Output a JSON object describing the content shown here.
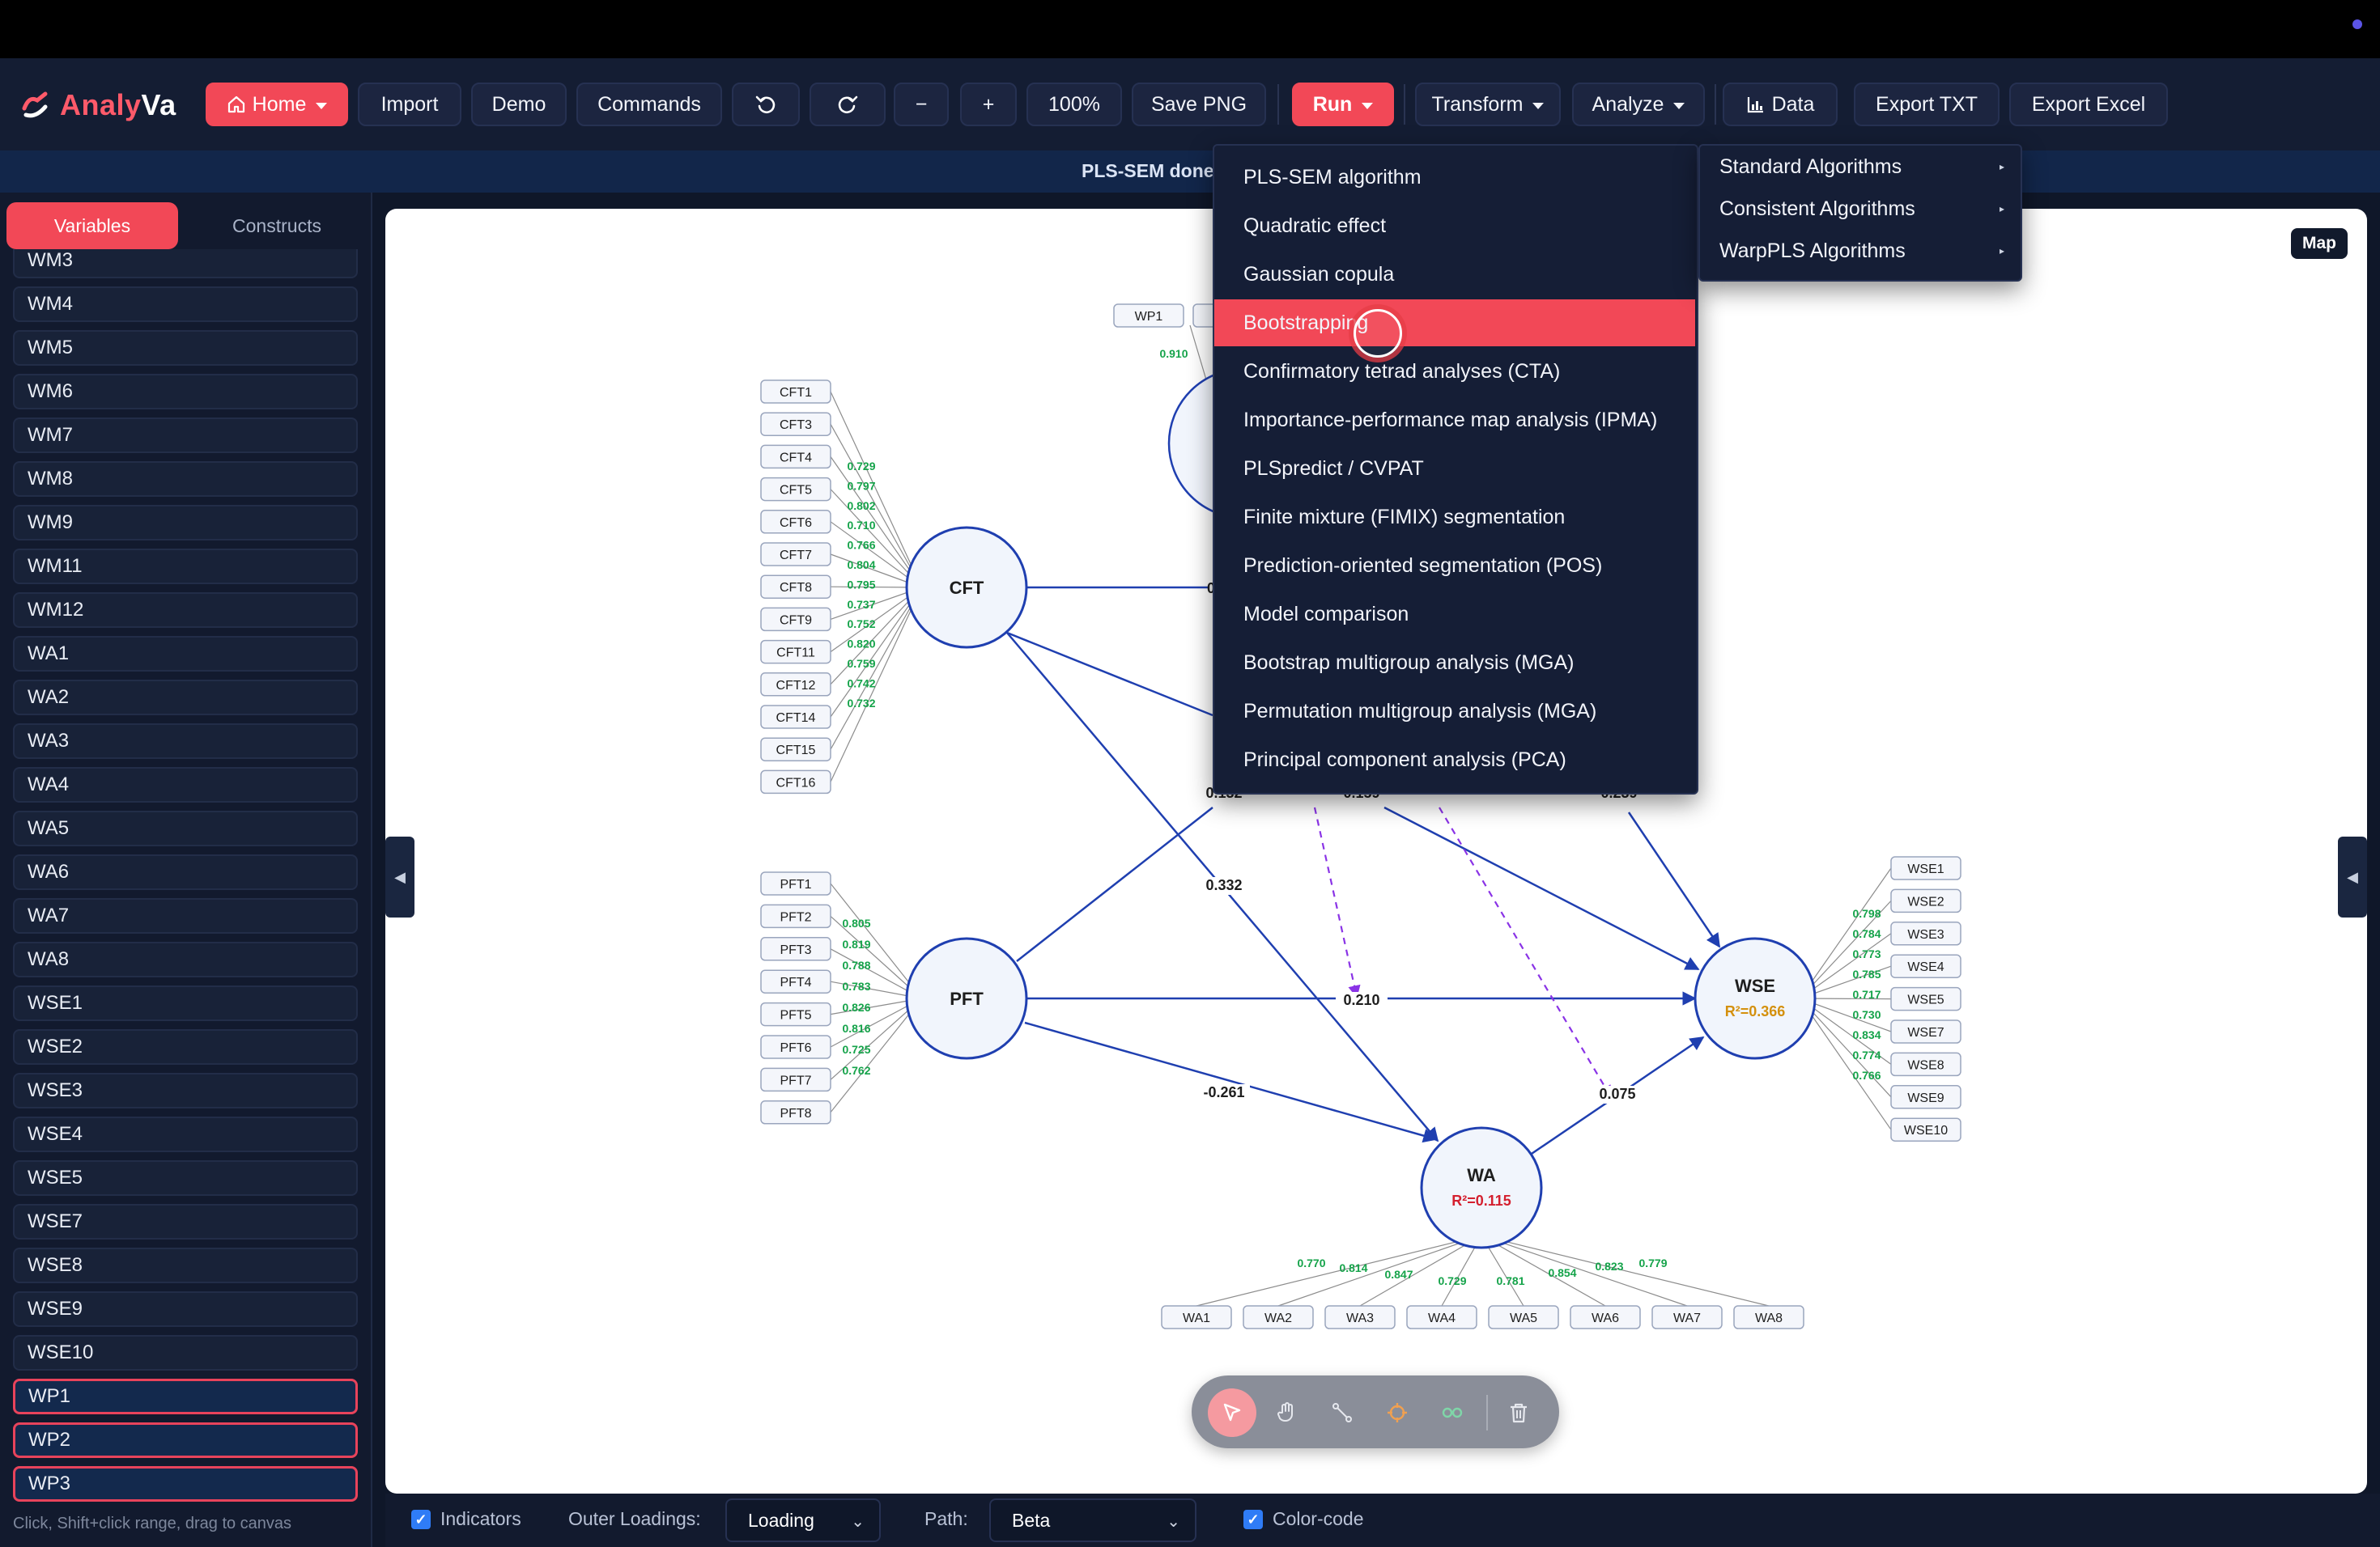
{
  "app": {
    "logo_part1": "Analy",
    "logo_part2": "Va"
  },
  "toolbar": {
    "home": "Home",
    "import": "Import",
    "demo": "Demo",
    "commands": "Commands",
    "zoom_out": "−",
    "zoom_in": "+",
    "zoom": "100%",
    "save_png": "Save PNG",
    "run": "Run",
    "transform": "Transform",
    "analyze": "Analyze",
    "data": "Data",
    "export_txt": "Export TXT",
    "export_excel": "Export Excel"
  },
  "status": {
    "text": "PLS-SEM done"
  },
  "sidebar": {
    "tabs": [
      "Variables",
      "Constructs"
    ],
    "variables": [
      "WM3",
      "WM4",
      "WM5",
      "WM6",
      "WM7",
      "WM8",
      "WM9",
      "WM11",
      "WM12",
      "WA1",
      "WA2",
      "WA3",
      "WA4",
      "WA5",
      "WA6",
      "WA7",
      "WA8",
      "WSE1",
      "WSE2",
      "WSE3",
      "WSE4",
      "WSE5",
      "WSE7",
      "WSE8",
      "WSE9",
      "WSE10",
      "WP1",
      "WP2",
      "WP3"
    ],
    "selected": [
      "WP1",
      "WP2",
      "WP3"
    ],
    "hint": "Click, Shift+click range, drag to canvas"
  },
  "canvas": {
    "map_button": "Map",
    "left_handle": "◀",
    "right_handle": "◀"
  },
  "run_menu": {
    "items": [
      "PLS-SEM algorithm",
      "Quadratic effect",
      "Gaussian copula",
      "Bootstrapping",
      "Confirmatory tetrad analyses (CTA)",
      "Importance-performance map analysis (IPMA)",
      "PLSpredict / CVPAT",
      "Finite mixture (FIMIX) segmentation",
      "Prediction-oriented segmentation (POS)",
      "Model comparison",
      "Bootstrap multigroup analysis (MGA)",
      "Permutation multigroup analysis (MGA)",
      "Principal component analysis (PCA)"
    ],
    "highlighted": "Bootstrapping"
  },
  "algorithm_menu": {
    "items": [
      "Standard Algorithms",
      "Consistent Algorithms",
      "WarpPLS Algorithms"
    ]
  },
  "model": {
    "constructs": {
      "cft": {
        "name": "CFT"
      },
      "pft": {
        "name": "PFT"
      },
      "wa": {
        "name": "WA",
        "r2": "R²=0.115"
      },
      "wse": {
        "name": "WSE",
        "r2": "R²=0.366"
      },
      "wp_partial": {
        "name": ""
      }
    },
    "cft_indicators": [
      "CFT1",
      "CFT3",
      "CFT4",
      "CFT5",
      "CFT6",
      "CFT7",
      "CFT8",
      "CFT9",
      "CFT11",
      "CFT12",
      "CFT14",
      "CFT15",
      "CFT16"
    ],
    "cft_loadings": [
      "0.729",
      "0.797",
      "0.802",
      "0.710",
      "0.766",
      "0.804",
      "0.795",
      "0.737",
      "0.752",
      "0.820",
      "0.759",
      "0.742",
      "0.732"
    ],
    "pft_indicators": [
      "PFT1",
      "PFT2",
      "PFT3",
      "PFT4",
      "PFT5",
      "PFT6",
      "PFT7",
      "PFT8"
    ],
    "pft_loadings": [
      "0.805",
      "0.819",
      "0.788",
      "0.783",
      "0.826",
      "0.816",
      "0.725",
      "0.762"
    ],
    "wse_indicators": [
      "WSE1",
      "WSE2",
      "WSE3",
      "WSE4",
      "WSE5",
      "WSE7",
      "WSE8",
      "WSE9",
      "WSE10"
    ],
    "wse_loadings": [
      "0.798",
      "0.784",
      "0.773",
      "0.785",
      "0.717",
      "0.730",
      "0.834",
      "0.774",
      "0.766"
    ],
    "wa_indicators": [
      "WA1",
      "WA2",
      "WA3",
      "WA4",
      "WA5",
      "WA6",
      "WA7",
      "WA8"
    ],
    "wa_loadings": [
      "0.770",
      "0.814",
      "0.847",
      "0.729",
      "0.781",
      "0.854",
      "0.823",
      "0.779"
    ],
    "wp_indicator": "WP1",
    "wp_loading": "0.910",
    "paths": {
      "cft_wa": "0.332",
      "pft_wa": "-0.261",
      "pft_wse": "0.210",
      "wa_wse": "0.075",
      "p1": "0.132",
      "p2": "0.159",
      "p3": "0.239",
      "cft_partial": "0"
    }
  },
  "bottom": {
    "indicators_label": "Indicators",
    "outer_loadings_label": "Outer Loadings:",
    "outer_loadings_value": "Loading",
    "path_label": "Path:",
    "path_value": "Beta",
    "colorcode_label": "Color-code"
  },
  "colors": {
    "accent": "#f24857",
    "construct_stroke": "#1f3fb0",
    "loading_green": "#15a34a",
    "r2_wse": "#d4900d",
    "r2_wa": "#d4202f"
  }
}
